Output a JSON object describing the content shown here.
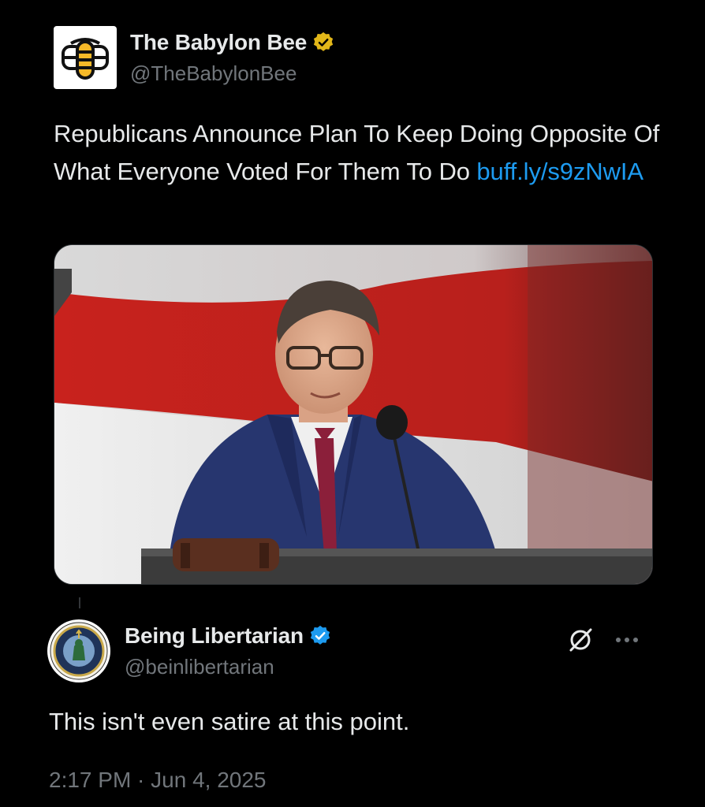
{
  "quoted_post": {
    "display_name": "The Babylon Bee",
    "handle": "@TheBabylonBee",
    "verified": "gold",
    "text": "Republicans Announce Plan To Keep Doing Opposite Of What Everyone Voted For Them To Do ",
    "link": "buff.ly/s9zNwIA",
    "image": "photo-speaker-at-podium"
  },
  "reply_post": {
    "display_name": "Being Libertarian",
    "handle": "@beinlibertarian",
    "verified": "blue",
    "text": "This isn't even satire at this point.",
    "timestamp": "2:17 PM · Jun 4, 2025"
  },
  "colors": {
    "background": "#000000",
    "primary_text": "#e7e9ea",
    "secondary_text": "#71767b",
    "link": "#1d9bf0",
    "gold_badge": "#e2b719",
    "blue_badge": "#1d9bf0"
  },
  "icons": {
    "grok": "grok-icon",
    "more": "more-icon",
    "verified_gold": "verified-gold-icon",
    "verified_blue": "verified-blue-icon"
  }
}
